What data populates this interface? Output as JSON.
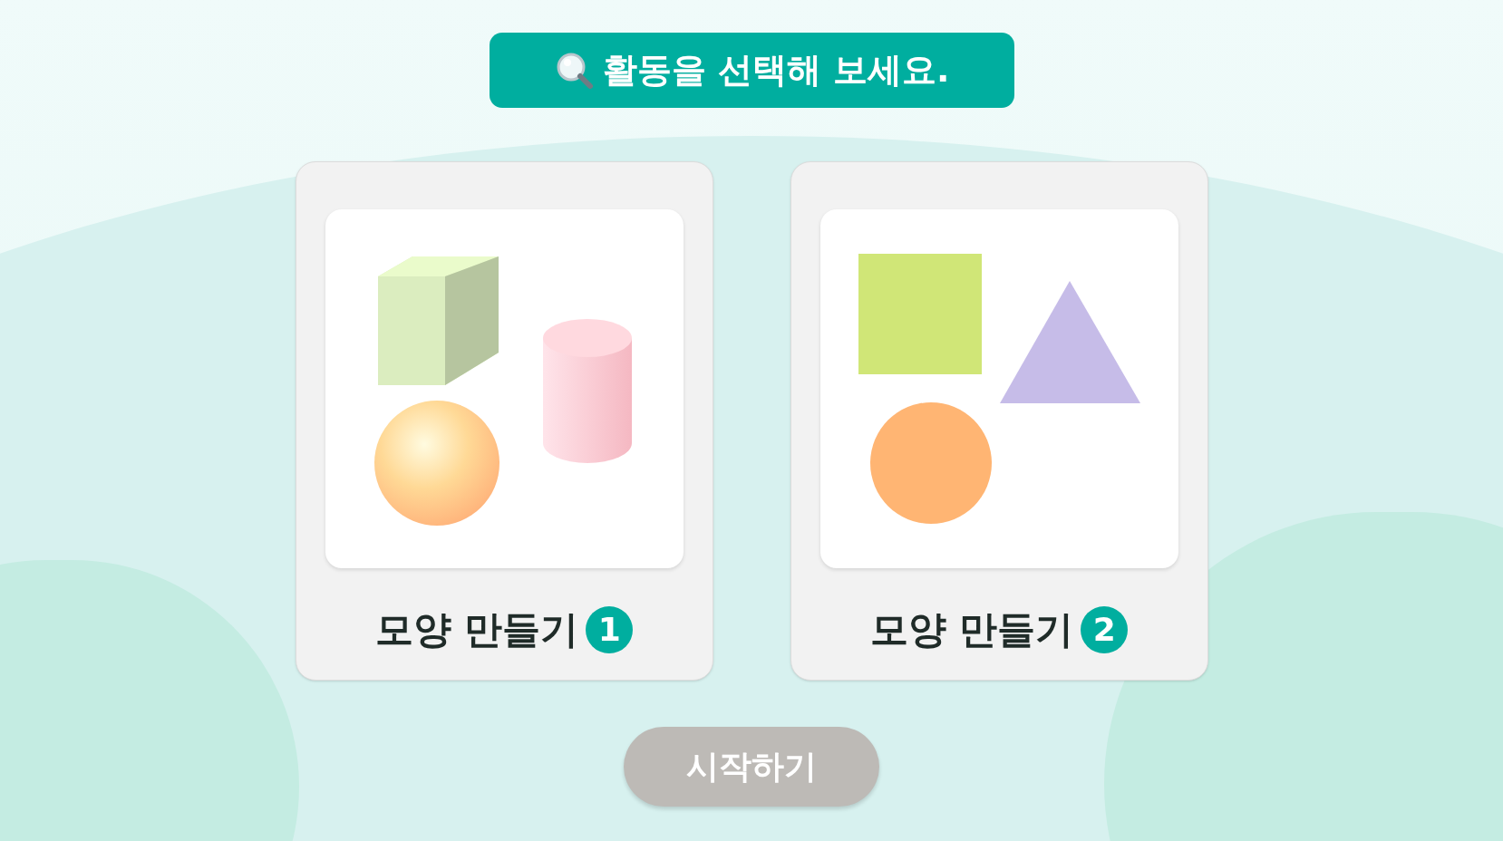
{
  "title": "활동을 선택해 보세요.",
  "cards": [
    {
      "kind": "solids",
      "label": "모양 만들기",
      "number": "1",
      "selected": false
    },
    {
      "kind": "plane",
      "label": "모양 만들기",
      "number": "2",
      "selected": false
    }
  ],
  "start_button": {
    "label": "시작하기",
    "disabled": true
  }
}
